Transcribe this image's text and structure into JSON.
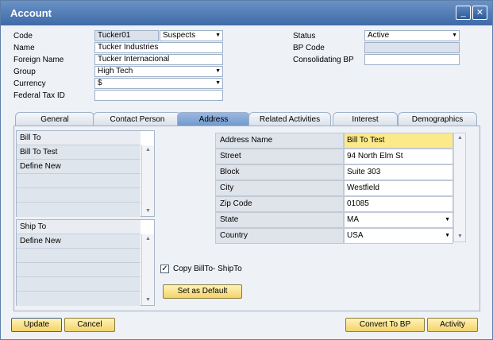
{
  "window": {
    "title": "Account",
    "minimize_glyph": "_",
    "close_glyph": "✕"
  },
  "header": {
    "code_label": "Code",
    "code_value": "Tucker01",
    "code_type": "Suspects",
    "name_label": "Name",
    "name_value": "Tucker Industries",
    "foreign_label": "Foreign Name",
    "foreign_value": "Tucker Internacional",
    "group_label": "Group",
    "group_value": "High Tech",
    "currency_label": "Currency",
    "currency_value": "$",
    "taxid_label": "Federal Tax ID",
    "taxid_value": "",
    "status_label": "Status",
    "status_value": "Active",
    "bpcode_label": "BP Code",
    "bpcode_value": "",
    "consol_label": "Consolidating BP",
    "consol_value": ""
  },
  "tabs": [
    "General",
    "Contact Person",
    "Address",
    "Related Activities",
    "Interest",
    "Demographics"
  ],
  "active_tab": "Address",
  "bill_to": {
    "header": "Bill To",
    "items": [
      "Bill To Test",
      "Define New"
    ]
  },
  "ship_to": {
    "header": "Ship To",
    "items": [
      "Define New"
    ]
  },
  "address": {
    "rows": [
      {
        "label": "Address Name",
        "value": "Bill To Test"
      },
      {
        "label": "Street",
        "value": "94 North Elm St"
      },
      {
        "label": "Block",
        "value": "Suite 303"
      },
      {
        "label": "City",
        "value": "Westfield"
      },
      {
        "label": "Zip Code",
        "value": "01085"
      },
      {
        "label": "State",
        "value": "MA"
      },
      {
        "label": "Country",
        "value": "USA"
      }
    ]
  },
  "copy_checkbox": {
    "label": "Copy BillTo- ShipTo",
    "checked": true,
    "mark": "✓"
  },
  "buttons": {
    "set_default": "Set as Default",
    "update": "Update",
    "cancel": "Cancel",
    "convert": "Convert To BP",
    "activity": "Activity"
  },
  "icons": {
    "up": "▲",
    "down": "▼"
  },
  "colors": {
    "accent": "#f3d36a",
    "title_bar": "#3f6aa6",
    "highlight": "#fce98a"
  }
}
